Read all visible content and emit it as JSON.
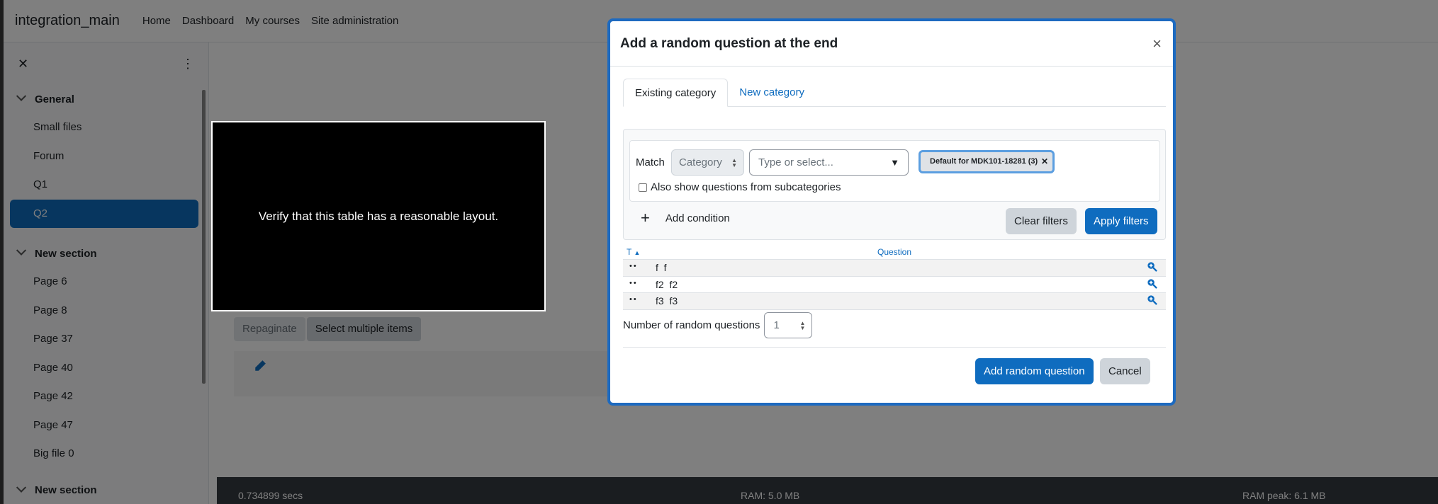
{
  "navbar": {
    "site_name": "integration_main",
    "links": [
      "Home",
      "Dashboard",
      "My courses",
      "Site administration"
    ]
  },
  "drawer": {
    "close_glyph": "✕",
    "menu_glyph": "⋮",
    "sections": [
      {
        "title": "General",
        "items": [
          "Small files",
          "Forum",
          "Q1",
          "Q2"
        ],
        "active_item": "Q2"
      },
      {
        "title": "New section",
        "items": [
          "Page 6",
          "Page 8",
          "Page 37",
          "Page 40",
          "Page 42",
          "Page 47",
          "Big file 0"
        ]
      },
      {
        "title": "New section",
        "items": []
      }
    ]
  },
  "main": {
    "repaginate_label": "Repaginate",
    "select_multiple_label": "Select multiple items"
  },
  "footer": {
    "secs": "0.734899 secs",
    "ram": "RAM: 5.0 MB",
    "ram_peak": "RAM peak: 6.1 MB"
  },
  "overlay": {
    "message": "Verify that this table has a reasonable layout."
  },
  "modal": {
    "title": "Add a random question at the end",
    "close_glyph": "×",
    "tabs": [
      {
        "label": "Existing category",
        "active": true
      },
      {
        "label": "New category",
        "active": false
      }
    ],
    "filter": {
      "match_label": "Match",
      "category_select": "Category",
      "combo_placeholder": "Type or select...",
      "selected_badge": "Default for MDK101-18281 (3)",
      "subcategories_label": "Also show questions from subcategories",
      "add_condition_label": "Add condition",
      "clear_filters_label": "Clear filters",
      "apply_filters_label": "Apply filters"
    },
    "table": {
      "headers": {
        "type": "T",
        "question": "Question"
      },
      "rows": [
        {
          "name": "f",
          "text": "f"
        },
        {
          "name": "f2",
          "text": "f2"
        },
        {
          "name": "f3",
          "text": "f3"
        }
      ]
    },
    "number_label": "Number of random questions",
    "number_value": "1",
    "add_button": "Add random question",
    "cancel_button": "Cancel"
  },
  "colors": {
    "primary": "#0f6cbf",
    "modal_border": "#1d6ac0",
    "footer_bg": "#343a40"
  }
}
